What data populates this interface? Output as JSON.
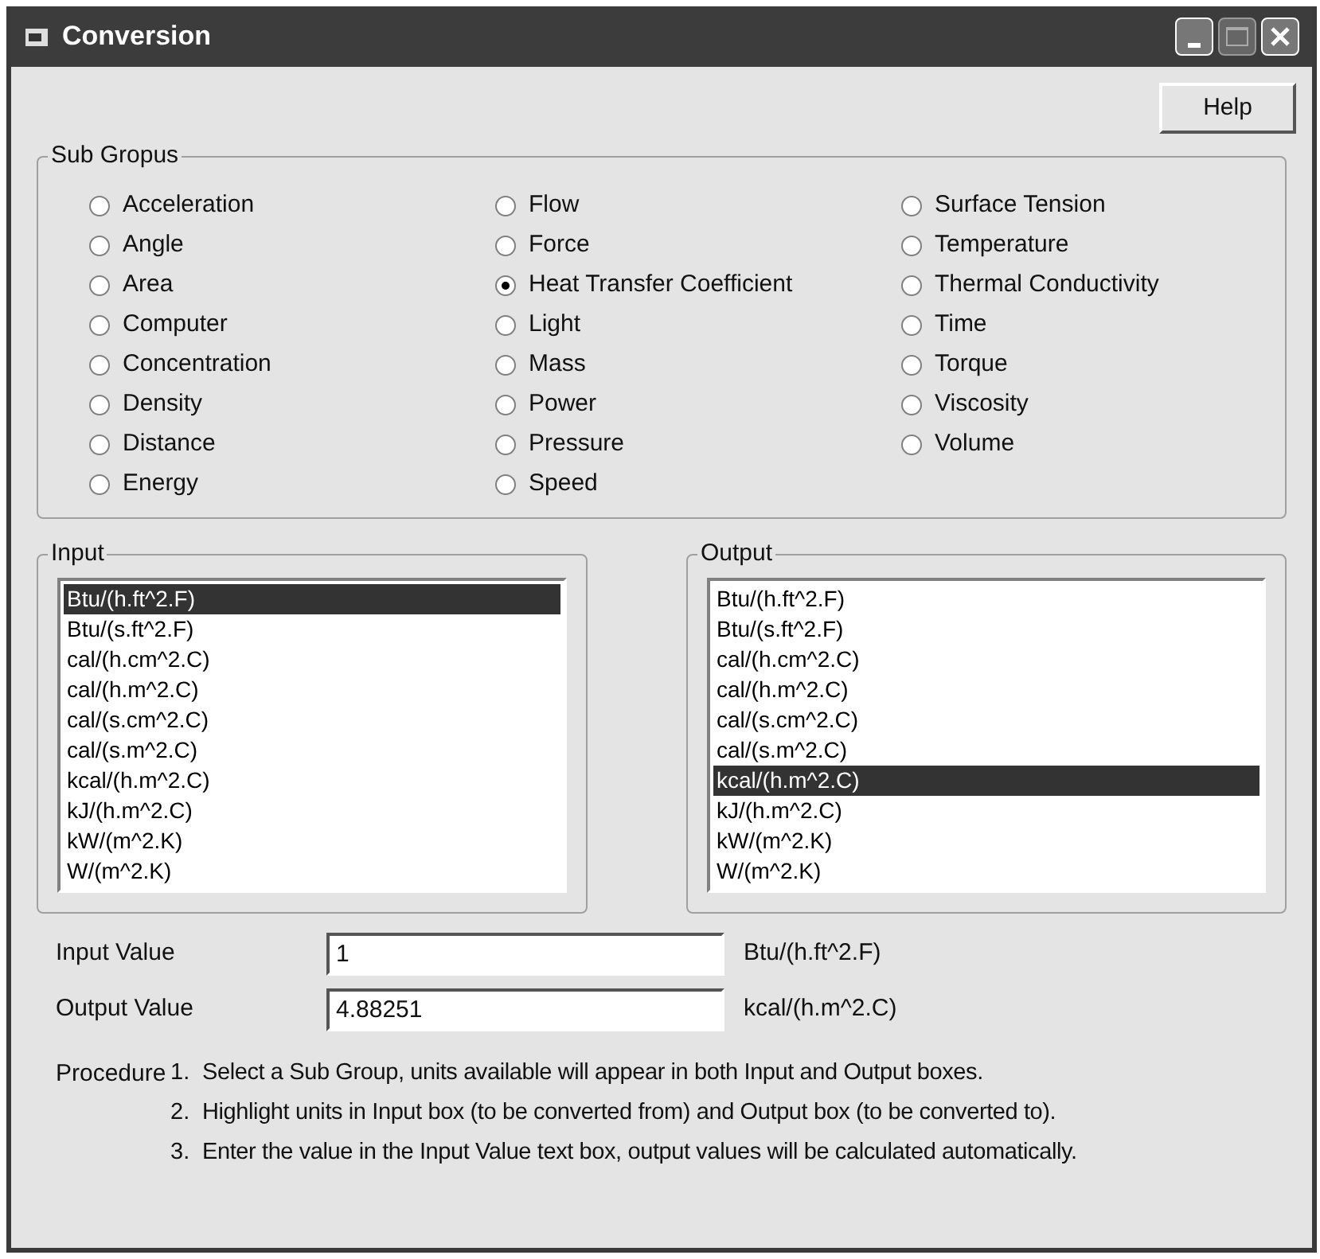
{
  "window": {
    "title": "Conversion"
  },
  "help_button": "Help",
  "sub_groups": {
    "label": "Sub Gropus",
    "options": [
      {
        "label": "Acceleration",
        "selected": false
      },
      {
        "label": "Angle",
        "selected": false
      },
      {
        "label": "Area",
        "selected": false
      },
      {
        "label": "Computer",
        "selected": false
      },
      {
        "label": "Concentration",
        "selected": false
      },
      {
        "label": "Density",
        "selected": false
      },
      {
        "label": "Distance",
        "selected": false
      },
      {
        "label": "Energy",
        "selected": false
      },
      {
        "label": "Flow",
        "selected": false
      },
      {
        "label": "Force",
        "selected": false
      },
      {
        "label": "Heat Transfer Coefficient",
        "selected": true
      },
      {
        "label": "Light",
        "selected": false
      },
      {
        "label": "Mass",
        "selected": false
      },
      {
        "label": "Power",
        "selected": false
      },
      {
        "label": "Pressure",
        "selected": false
      },
      {
        "label": "Speed",
        "selected": false
      },
      {
        "label": "Surface Tension",
        "selected": false
      },
      {
        "label": "Temperature",
        "selected": false
      },
      {
        "label": "Thermal Conductivity",
        "selected": false
      },
      {
        "label": "Time",
        "selected": false
      },
      {
        "label": "Torque",
        "selected": false
      },
      {
        "label": "Viscosity",
        "selected": false
      },
      {
        "label": "Volume",
        "selected": false
      }
    ]
  },
  "input": {
    "label": "Input",
    "items": [
      {
        "label": "Btu/(h.ft^2.F)",
        "selected": true
      },
      {
        "label": "Btu/(s.ft^2.F)",
        "selected": false
      },
      {
        "label": "cal/(h.cm^2.C)",
        "selected": false
      },
      {
        "label": "cal/(h.m^2.C)",
        "selected": false
      },
      {
        "label": "cal/(s.cm^2.C)",
        "selected": false
      },
      {
        "label": "cal/(s.m^2.C)",
        "selected": false
      },
      {
        "label": "kcal/(h.m^2.C)",
        "selected": false
      },
      {
        "label": "kJ/(h.m^2.C)",
        "selected": false
      },
      {
        "label": "kW/(m^2.K)",
        "selected": false
      },
      {
        "label": "W/(m^2.K)",
        "selected": false
      }
    ]
  },
  "output": {
    "label": "Output",
    "items": [
      {
        "label": "Btu/(h.ft^2.F)",
        "selected": false
      },
      {
        "label": "Btu/(s.ft^2.F)",
        "selected": false
      },
      {
        "label": "cal/(h.cm^2.C)",
        "selected": false
      },
      {
        "label": "cal/(h.m^2.C)",
        "selected": false
      },
      {
        "label": "cal/(s.cm^2.C)",
        "selected": false
      },
      {
        "label": "cal/(s.m^2.C)",
        "selected": false
      },
      {
        "label": "kcal/(h.m^2.C)",
        "selected": true
      },
      {
        "label": "kJ/(h.m^2.C)",
        "selected": false
      },
      {
        "label": "kW/(m^2.K)",
        "selected": false
      },
      {
        "label": "W/(m^2.K)",
        "selected": false
      }
    ]
  },
  "values": [
    {
      "label": "Input Value",
      "value": "1",
      "unit": "Btu/(h.ft^2.F)"
    },
    {
      "label": "Output Value",
      "value": "4.88251",
      "unit": "kcal/(h.m^2.C)"
    }
  ],
  "procedure": {
    "label": "Procedure",
    "steps": [
      {
        "number": "1.",
        "text": "Select a Sub Group, units available will appear in both Input and Output boxes."
      },
      {
        "number": "2.",
        "text": "Highlight units in Input box (to be converted from) and Output box (to be converted to)."
      },
      {
        "number": "3.",
        "text": "Enter the value in the Input Value text box, output values will be calculated automatically."
      }
    ]
  }
}
